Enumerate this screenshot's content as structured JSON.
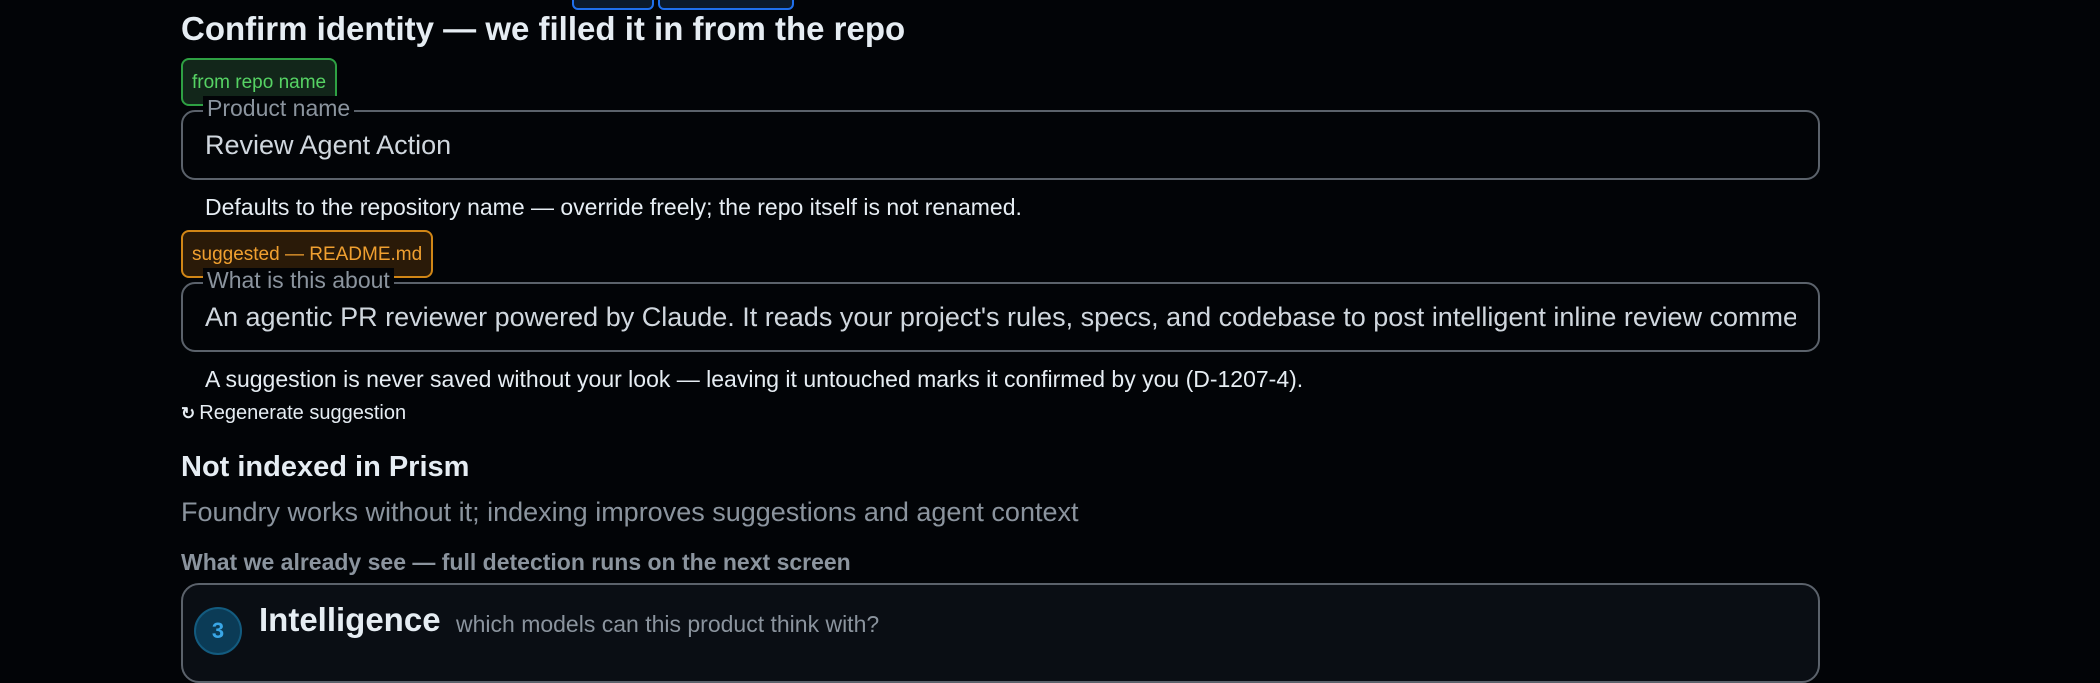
{
  "identity": {
    "heading": "Confirm identity — we filled it in from the repo",
    "product_name": {
      "badge": "from repo name",
      "label": "Product name",
      "value": "Review Agent Action",
      "help": "Defaults to the repository name — override freely; the repo itself is not renamed."
    },
    "about": {
      "badge": "suggested — README.md",
      "label": "What is this about",
      "value": "An agentic PR reviewer powered by Claude. It reads your project's rules, specs, and codebase to post intelligent inline review comments",
      "help": "A suggestion is never saved without your look — leaving it untouched marks it confirmed by you (D-1207-4)."
    },
    "regenerate": {
      "icon": "refresh-icon",
      "icon_glyph": "↻",
      "label": "Regenerate suggestion"
    }
  },
  "prism": {
    "heading": "Not indexed in Prism",
    "subtitle": "Foundry works without it; indexing improves suggestions and agent context",
    "detection_note": "What we already see — full detection runs on the next screen"
  },
  "step": {
    "number": "3",
    "title": "Intelligence",
    "subtitle": "which models can this product think with?"
  },
  "colors": {
    "background": "#020407",
    "badge_green": "#56d364",
    "badge_orange": "#f0a030",
    "step_accent": "#39a6e6"
  }
}
